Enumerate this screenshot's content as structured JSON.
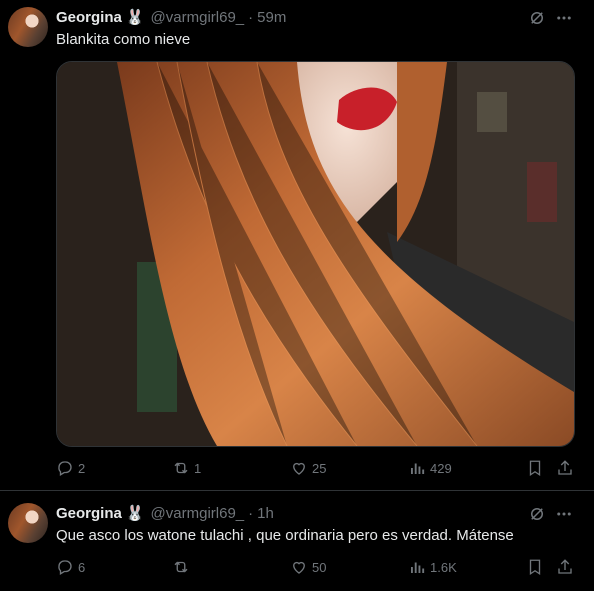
{
  "tweets": [
    {
      "author": {
        "name": "Georgina",
        "badge": "🐰",
        "handle": "@varmgirl69_",
        "time": "59m"
      },
      "text": "Blankita como nieve",
      "media": {
        "description": "photo"
      },
      "stats": {
        "replies": "2",
        "retweets": "1",
        "likes": "25",
        "views": "429"
      }
    },
    {
      "author": {
        "name": "Georgina",
        "badge": "🐰",
        "handle": "@varmgirl69_",
        "time": "1h"
      },
      "text": "Que asco los watone tulachi , que ordinaria pero es verdad. Mátense",
      "stats": {
        "replies": "6",
        "retweets": "",
        "likes": "50",
        "views": "1.6K"
      }
    }
  ],
  "icons": {
    "grok": "grok-icon",
    "more": "more-icon",
    "reply": "reply-icon",
    "retweet": "retweet-icon",
    "like": "like-icon",
    "views": "views-icon",
    "bookmark": "bookmark-icon",
    "share": "share-icon"
  },
  "colors": {
    "background": "#000000",
    "text": "#e7e9ea",
    "muted": "#71767b",
    "border": "#2f3336"
  }
}
